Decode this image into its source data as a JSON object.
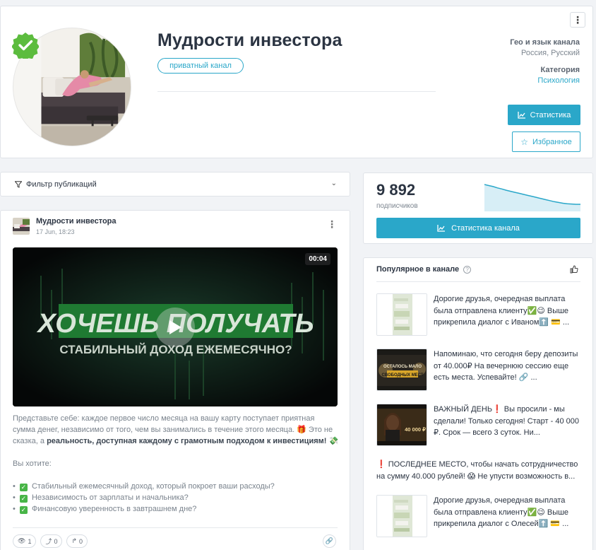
{
  "header": {
    "title": "Мудрости инвестора",
    "private_label": "приватный канал",
    "geo_label": "Гео и язык канала",
    "geo_value": "Россия, Русский",
    "category_label": "Категория",
    "category_value": "Психология",
    "stats_button": "Статистика",
    "favorite_button": "Избранное"
  },
  "filter": {
    "label": "Фильтр публикаций"
  },
  "post": {
    "author": "Мудрости инвестора",
    "date": "17 Jun, 18:23",
    "video_duration": "00:04",
    "video_line1": "ХОЧЕШЬ ПОЛУЧАТЬ",
    "video_line2": "СТАБИЛЬНЫЙ ДОХОД ЕЖЕМЕСЯЧНО?",
    "text_p1": "Представьте себе: каждое первое число месяца на вашу карту поступает приятная сумма денег, независимо от того, чем вы занимались в течение этого месяца. 🎁 Это не сказка, а ",
    "text_p1_bold": "реальность, доступная каждому с грамотным подходом к инвестициям!",
    "text_p1_tail": " 💸",
    "text_p2": "Вы хотите:",
    "bullets": [
      "Стабильный ежемесячный доход, который покроет ваши расходы?",
      "Независимость от зарплаты и начальника?",
      "Финансовую уверенность в завтрашнем дне?"
    ],
    "views": "1",
    "shares": "0",
    "forwards": "0"
  },
  "subscribers": {
    "count": "9 892",
    "label": "подписчиков",
    "button": "Статистика канала",
    "trend": [
      100,
      96,
      92,
      87,
      83,
      78,
      74,
      70,
      66,
      62,
      58,
      54,
      50,
      46,
      42,
      38,
      34,
      31,
      28,
      26,
      25,
      24,
      24
    ]
  },
  "popular": {
    "title": "Популярное в канале",
    "items": [
      {
        "text": "Дорогие друзья, очередная выплата была отправлена клиенту✅😉 Выше прикрепила диалог с Иваном⬆️ 💳 ...",
        "thumb": "chat"
      },
      {
        "text": "Напоминаю, что сегодня беру депозиты от 40.000₽ На вечернюю сессию еще есть места. Успевайте! 🔗 ...",
        "thumb": "promo",
        "thumb_text1": "ОСТАЛОСЬ МАЛО",
        "thumb_text2": "СВОБОДНЫХ МЕСТ"
      },
      {
        "text": "ВАЖНЫЙ ДЕНЬ❗ Вы просили - мы сделали! Только сегодня! Старт - 40 000 ₽. Срок — всего 3 суток. Ни...",
        "thumb": "woman",
        "thumb_text1": "40 000 ₽"
      },
      {
        "text": "❗ ПОСЛЕДНЕЕ МЕСТО, чтобы начать сотрудничество на сумму 40.000 рублей! 😱 Не упусти возможность в...",
        "thumb": "none"
      },
      {
        "text": "Дорогие друзья, очередная выплата была отправлена клиенту✅😉 Выше прикрепила диалог с Олесей⬆️ 💳 ...",
        "thumb": "chat"
      }
    ]
  }
}
